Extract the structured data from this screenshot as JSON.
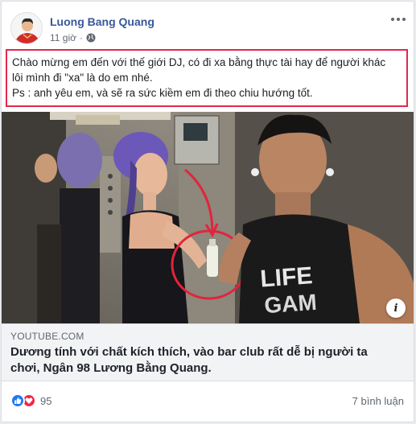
{
  "post": {
    "author": "Luong Bang Quang",
    "time": "11 giờ",
    "privacy_icon": "globe-icon",
    "more_icon": "more-dots-icon",
    "text_line1": "Chào mừng em đến với thế giới DJ, có đi xa bằng thực tài hay để người khác",
    "text_line2": "lôi mình đi \"xa\" là do em nhé.",
    "text_line3": "Ps : anh yêu em, và sẽ ra sức kiềm em đi theo chiu hướng tốt."
  },
  "link_preview": {
    "domain": "YOUTUBE.COM",
    "title": "Dương tính với chất kích thích, vào bar club rất dễ bị người ta chơi, Ngân 98 Lương Bằng Quang.",
    "info_label": "i"
  },
  "footer": {
    "reaction_count": "95",
    "comments": "7 bình luận"
  },
  "colors": {
    "author": "#385898",
    "highlight_border": "#e4274b",
    "like": "#2078f4",
    "love": "#f0284a"
  }
}
